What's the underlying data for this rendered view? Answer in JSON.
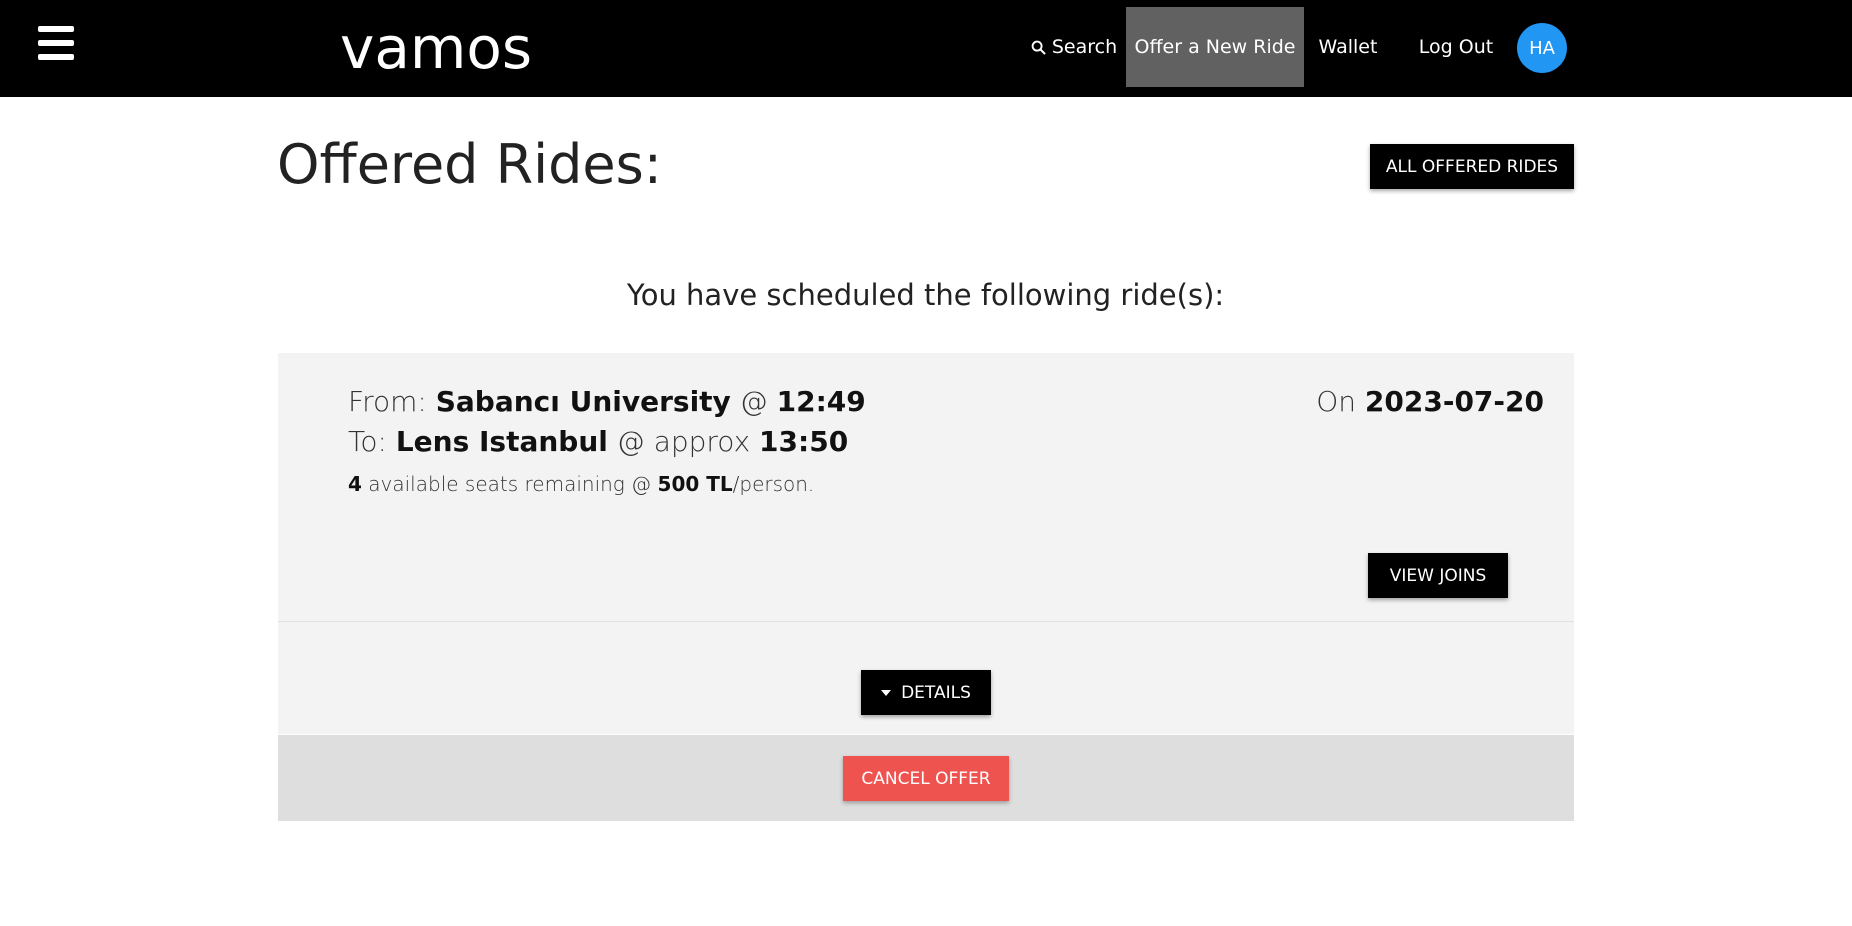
{
  "header": {
    "brand": "vamos",
    "nav": {
      "search": "Search",
      "offer_new_ride": "Offer a New Ride",
      "wallet": "Wallet",
      "logout": "Log Out"
    },
    "avatar_initials": "HA",
    "colors": {
      "bar": "#000000",
      "active_nav": "#616161",
      "avatar": "#2196f3"
    },
    "icons": {
      "menu": "hamburger-menu-icon",
      "search": "search-icon"
    }
  },
  "main": {
    "title": "Offered Rides:",
    "all_offered_button": "ALL OFFERED RIDES",
    "subtitle": "You have scheduled the following ride(s):"
  },
  "ride": {
    "from_label": "From:",
    "from_place": "Sabancı University",
    "from_at": "@",
    "from_time": "12:49",
    "to_label": "To:",
    "to_place": "Lens Istanbul",
    "to_at": "@ approx",
    "to_time": "13:50",
    "seats_count": "4",
    "seats_text": "available seats remaining @",
    "price": "500 TL",
    "price_unit": "/person.",
    "date_label": "On",
    "date": "2023-07-20",
    "view_joins_button": "VIEW JOINS",
    "details_button": "DETAILS",
    "cancel_button": "CANCEL OFFER",
    "cancel_color": "#ef5350"
  }
}
